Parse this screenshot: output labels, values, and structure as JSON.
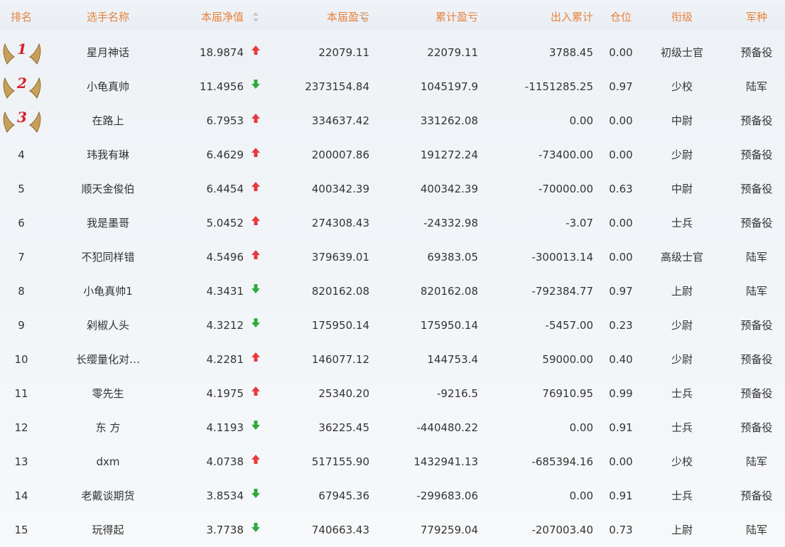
{
  "header": {
    "rank": "排名",
    "name": "选手名称",
    "nav": "本届净值",
    "pnl": "本届盈亏",
    "cumulative": "累计盈亏",
    "flow": "出入累计",
    "position": "仓位",
    "title": "衔级",
    "arm": "军种"
  },
  "colors": {
    "header_text": "#e8823a",
    "up": "#e8383d",
    "down": "#2eaa3c",
    "medal_number": "#d9202a",
    "sort_arrow": "#c9c9c9"
  },
  "rows": [
    {
      "rank": "1",
      "name": "星月神话",
      "nav": "18.9874",
      "trend": "up",
      "pnl": "22079.11",
      "cumulative": "22079.11",
      "flow": "3788.45",
      "position": "0.00",
      "title": "初级士官",
      "arm": "预备役"
    },
    {
      "rank": "2",
      "name": "小龟真帅",
      "nav": "11.4956",
      "trend": "down",
      "pnl": "2373154.84",
      "cumulative": "1045197.9",
      "flow": "-1151285.25",
      "position": "0.97",
      "title": "少校",
      "arm": "陆军"
    },
    {
      "rank": "3",
      "name": "在路上",
      "nav": "6.7953",
      "trend": "up",
      "pnl": "334637.42",
      "cumulative": "331262.08",
      "flow": "0.00",
      "position": "0.00",
      "title": "中尉",
      "arm": "预备役"
    },
    {
      "rank": "4",
      "name": "玮我有琳",
      "nav": "6.4629",
      "trend": "up",
      "pnl": "200007.86",
      "cumulative": "191272.24",
      "flow": "-73400.00",
      "position": "0.00",
      "title": "少尉",
      "arm": "预备役"
    },
    {
      "rank": "5",
      "name": "顺天金俊伯",
      "nav": "6.4454",
      "trend": "up",
      "pnl": "400342.39",
      "cumulative": "400342.39",
      "flow": "-70000.00",
      "position": "0.63",
      "title": "中尉",
      "arm": "预备役"
    },
    {
      "rank": "6",
      "name": "我是墨哥",
      "nav": "5.0452",
      "trend": "up",
      "pnl": "274308.43",
      "cumulative": "-24332.98",
      "flow": "-3.07",
      "position": "0.00",
      "title": "士兵",
      "arm": "预备役"
    },
    {
      "rank": "7",
      "name": "不犯同样错",
      "nav": "4.5496",
      "trend": "up",
      "pnl": "379639.01",
      "cumulative": "69383.05",
      "flow": "-300013.14",
      "position": "0.00",
      "title": "高级士官",
      "arm": "陆军"
    },
    {
      "rank": "8",
      "name": "小龟真帅1",
      "nav": "4.3431",
      "trend": "down",
      "pnl": "820162.08",
      "cumulative": "820162.08",
      "flow": "-792384.77",
      "position": "0.97",
      "title": "上尉",
      "arm": "陆军"
    },
    {
      "rank": "9",
      "name": "剁椒人头",
      "nav": "4.3212",
      "trend": "down",
      "pnl": "175950.14",
      "cumulative": "175950.14",
      "flow": "-5457.00",
      "position": "0.23",
      "title": "少尉",
      "arm": "预备役"
    },
    {
      "rank": "10",
      "name": "长缨量化对…",
      "nav": "4.2281",
      "trend": "up",
      "pnl": "146077.12",
      "cumulative": "144753.4",
      "flow": "59000.00",
      "position": "0.40",
      "title": "少尉",
      "arm": "预备役"
    },
    {
      "rank": "11",
      "name": "零先生",
      "nav": "4.1975",
      "trend": "up",
      "pnl": "25340.20",
      "cumulative": "-9216.5",
      "flow": "76910.95",
      "position": "0.99",
      "title": "士兵",
      "arm": "预备役"
    },
    {
      "rank": "12",
      "name": "东 方",
      "nav": "4.1193",
      "trend": "down",
      "pnl": "36225.45",
      "cumulative": "-440480.22",
      "flow": "0.00",
      "position": "0.91",
      "title": "士兵",
      "arm": "预备役"
    },
    {
      "rank": "13",
      "name": "dxm",
      "nav": "4.0738",
      "trend": "up",
      "pnl": "517155.90",
      "cumulative": "1432941.13",
      "flow": "-685394.16",
      "position": "0.00",
      "title": "少校",
      "arm": "陆军"
    },
    {
      "rank": "14",
      "name": "老戴谈期货",
      "nav": "3.8534",
      "trend": "down",
      "pnl": "67945.36",
      "cumulative": "-299683.06",
      "flow": "0.00",
      "position": "0.91",
      "title": "士兵",
      "arm": "预备役"
    },
    {
      "rank": "15",
      "name": "玩得起",
      "nav": "3.7738",
      "trend": "down",
      "pnl": "740663.43",
      "cumulative": "779259.04",
      "flow": "-207003.40",
      "position": "0.73",
      "title": "上尉",
      "arm": "陆军"
    }
  ]
}
